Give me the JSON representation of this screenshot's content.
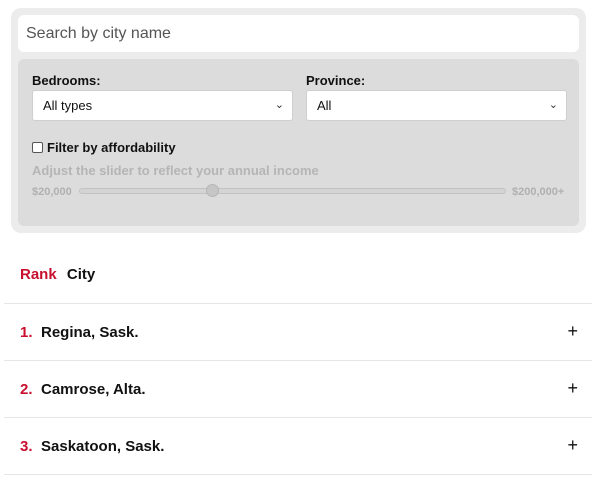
{
  "search": {
    "placeholder": "Search by city name"
  },
  "filters": {
    "bedrooms_label": "Bedrooms:",
    "bedrooms_value": "All types",
    "province_label": "Province:",
    "province_value": "All",
    "affordability_label": "Filter by affordability",
    "affordability_checked": false,
    "slider_hint": "Adjust the slider to reflect your annual income",
    "slider_min_label": "$20,000",
    "slider_max_label": "$200,000+",
    "slider_fraction": 0.31
  },
  "table": {
    "rank_header": "Rank",
    "city_header": "City",
    "rows": [
      {
        "rank": "1.",
        "city": "Regina, Sask.",
        "expand": "+"
      },
      {
        "rank": "2.",
        "city": "Camrose, Alta.",
        "expand": "+"
      },
      {
        "rank": "3.",
        "city": "Saskatoon, Sask.",
        "expand": "+"
      }
    ]
  },
  "colors": {
    "accent": "#c8102e",
    "panel": "#ececec",
    "filters_bg": "#dcdcdc"
  }
}
